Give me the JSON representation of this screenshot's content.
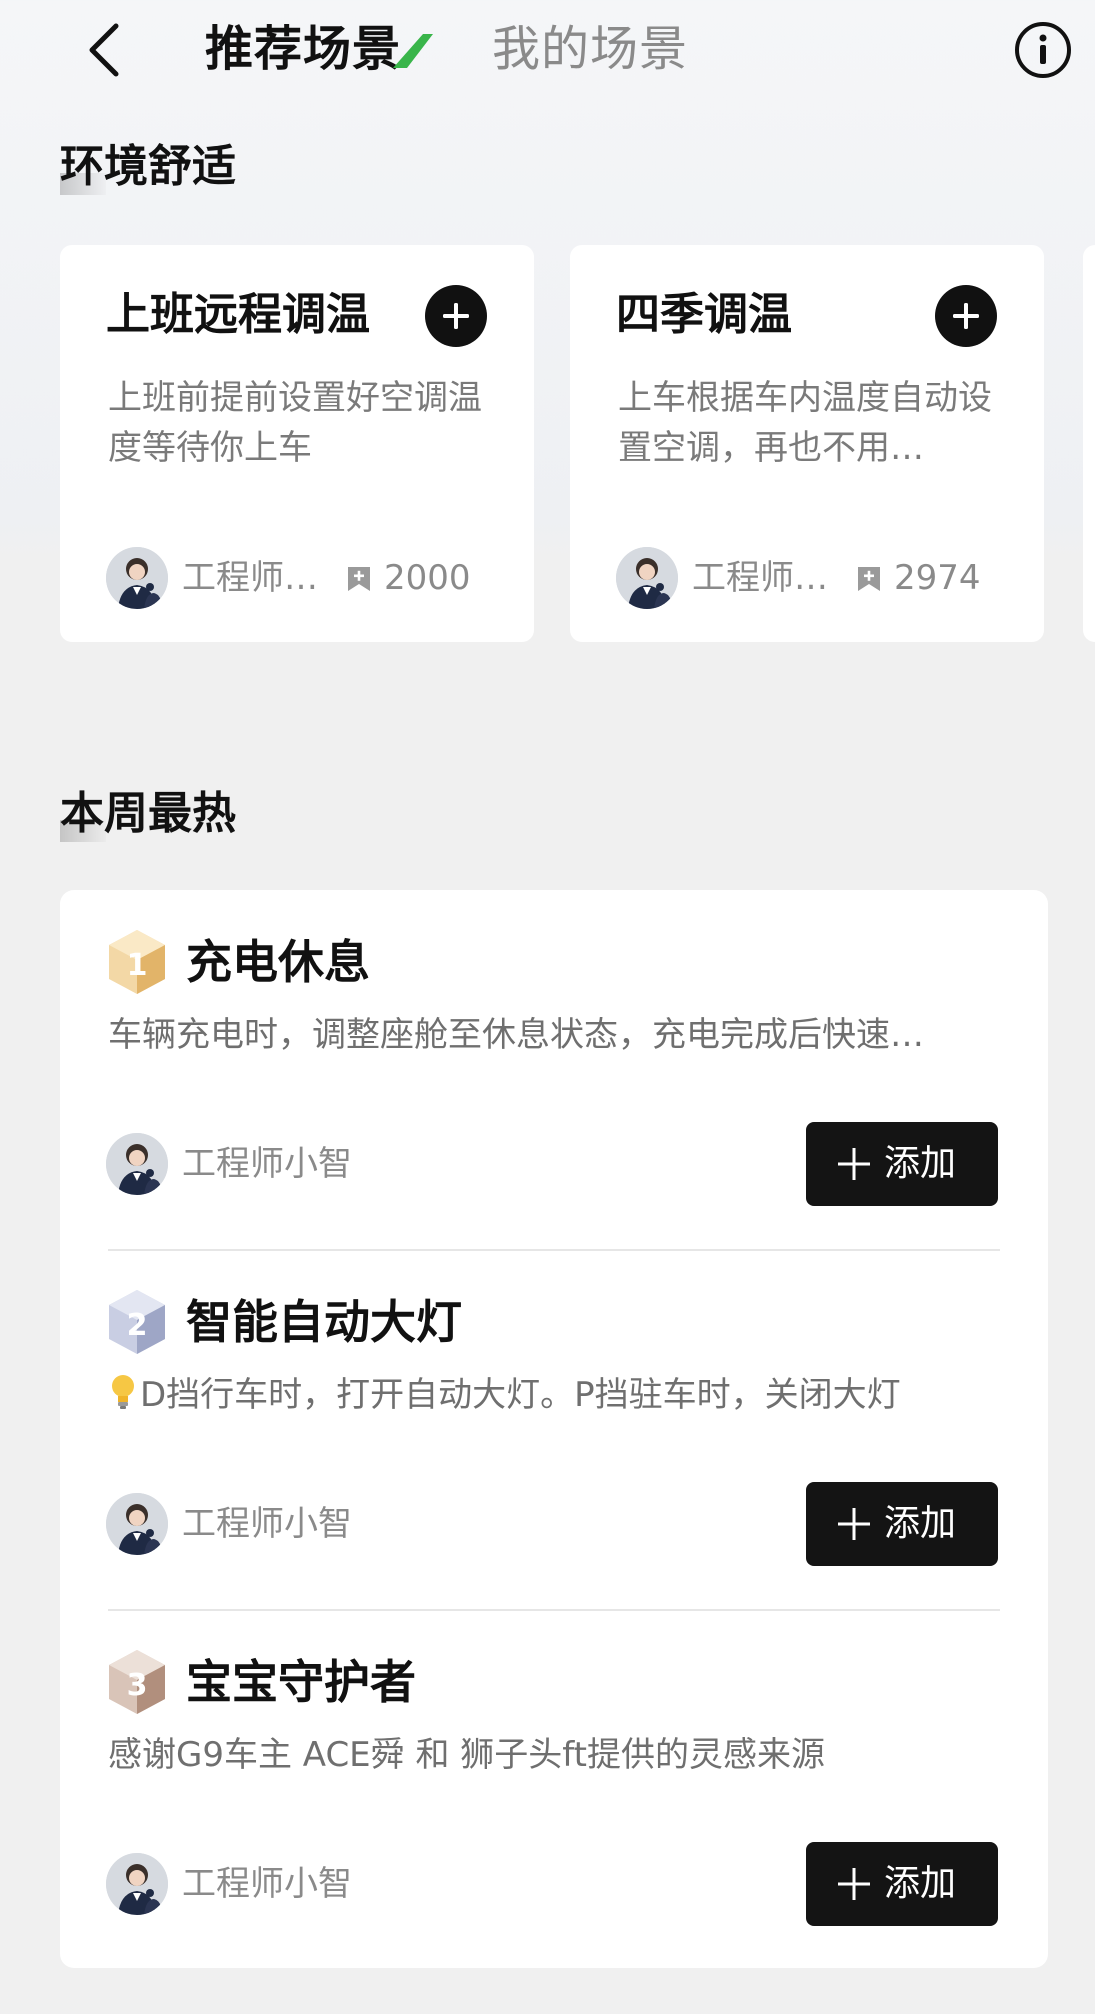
{
  "header": {
    "tabs": [
      {
        "label": "推荐场景",
        "active": true
      },
      {
        "label": "我的场景",
        "active": false
      }
    ],
    "back_icon": "chevron-left-icon",
    "info_icon": "info-circle-icon"
  },
  "comfort": {
    "title": "环境舒适",
    "cards": [
      {
        "title": "上班远程调温",
        "desc": "上班前提前设置好空调温度等待你上车",
        "author": "工程师…",
        "count": "2000",
        "add_icon": "plus-circle-icon"
      },
      {
        "title": "四季调温",
        "desc": "上车根据车内温度自动设置空调，再也不用…",
        "author": "工程师…",
        "count": "2974",
        "add_icon": "plus-circle-icon"
      }
    ]
  },
  "hot": {
    "title": "本周最热",
    "items": [
      {
        "rank": "1",
        "title": "充电休息",
        "desc": "车辆充电时，调整座舱至休息状态，充电完成后快速…",
        "author": "工程师小智",
        "button": "添加",
        "rank_color": "#e8b860"
      },
      {
        "rank": "2",
        "title": "智能自动大灯",
        "desc": "D挡行车时，打开自动大灯。P挡驻车时，关闭大灯",
        "desc_icon": "lightbulb-icon",
        "author": "工程师小智",
        "button": "添加",
        "rank_color": "#9fa6c4"
      },
      {
        "rank": "3",
        "title": "宝宝守护者",
        "desc": "感谢G9车主 ACE舜 和 狮子头ft提供的灵感来源",
        "author": "工程师小智",
        "button": "添加",
        "rank_color": "#b89a8a"
      }
    ]
  }
}
